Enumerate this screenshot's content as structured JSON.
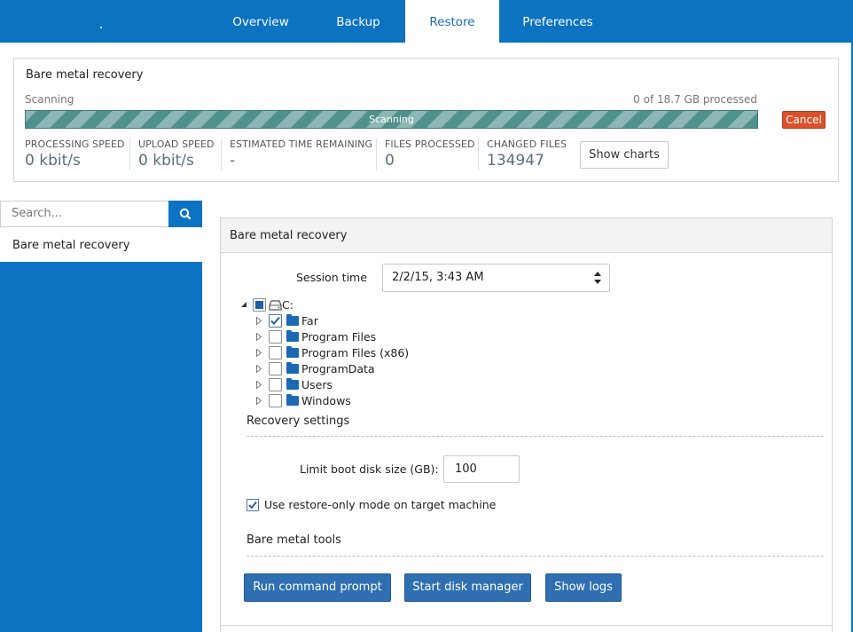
{
  "nav": {
    "tabs": [
      {
        "label": "Overview",
        "active": false
      },
      {
        "label": "Backup",
        "active": false
      },
      {
        "label": "Restore",
        "active": true
      },
      {
        "label": "Preferences",
        "active": false
      }
    ]
  },
  "status": {
    "title": "Bare metal recovery",
    "state_text": "Scanning",
    "processed_text": "0 of 18.7 GB processed",
    "progress_label": "Scanning",
    "progress_fraction": 0,
    "cancel_label": "Cancel",
    "stats": [
      {
        "label": "PROCESSING SPEED",
        "value": "0 kbit/s"
      },
      {
        "label": "UPLOAD SPEED",
        "value": "0 kbit/s"
      },
      {
        "label": "ESTIMATED TIME REMAINING",
        "value": "-"
      },
      {
        "label": "FILES PROCESSED",
        "value": "0"
      },
      {
        "label": "CHANGED FILES",
        "value": "134947"
      }
    ],
    "show_charts_label": "Show charts"
  },
  "sidebar": {
    "search_placeholder": "Search...",
    "items": [
      {
        "label": "Bare metal recovery"
      }
    ]
  },
  "main": {
    "title": "Bare metal recovery",
    "session_label": "Session time",
    "session_value": "2/2/15, 3:43 AM",
    "tree": {
      "root": {
        "label": "C:",
        "state": "partial"
      },
      "children": [
        {
          "label": "Far",
          "checked": true
        },
        {
          "label": "Program Files",
          "checked": false
        },
        {
          "label": "Program Files (x86)",
          "checked": false
        },
        {
          "label": "ProgramData",
          "checked": false
        },
        {
          "label": "Users",
          "checked": false
        },
        {
          "label": "Windows",
          "checked": false
        }
      ]
    },
    "recovery_settings_title": "Recovery settings",
    "limit_label": "Limit boot disk size (GB):",
    "limit_value": "100",
    "restore_only_label": "Use restore-only mode on target machine",
    "restore_only_checked": true,
    "tools_title": "Bare metal tools",
    "tools": [
      {
        "label": "Run command prompt"
      },
      {
        "label": "Start disk manager"
      },
      {
        "label": "Show logs"
      }
    ]
  },
  "colors": {
    "brand_blue": "#0b73c2",
    "progress_teal": "#4e8f8c",
    "cancel_red": "#d9502b",
    "button_blue": "#2f6fb1"
  }
}
